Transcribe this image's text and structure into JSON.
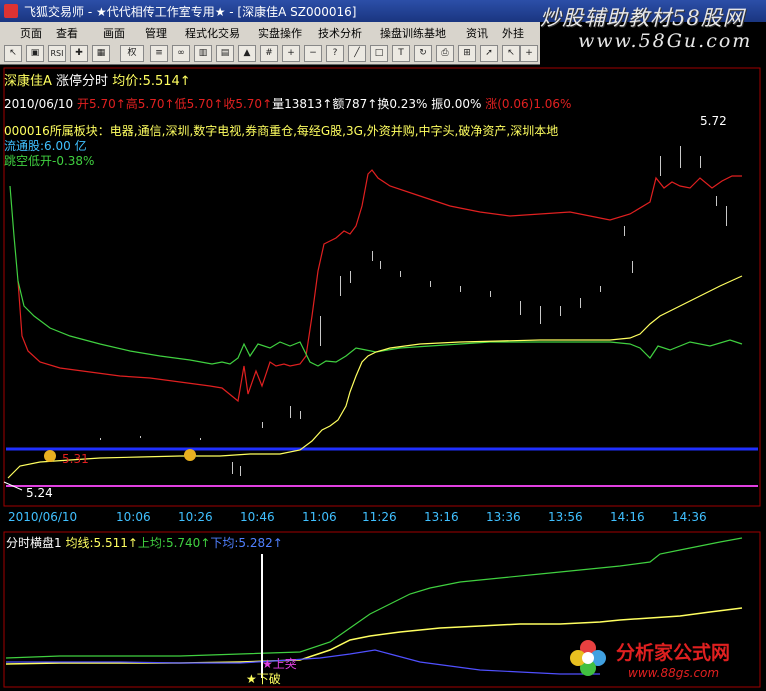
{
  "window": {
    "title": "飞狐交易师 - ★代代相传工作室专用★ - [深康佳A  SZ000016]"
  },
  "watermark": {
    "text": "炒股辅助教材58股网",
    "url": "www.58Gu.com"
  },
  "menu": {
    "items": [
      "页面",
      "查看",
      "画面",
      "管理",
      "程式化交易",
      "实盘操作",
      "技术分析",
      "操盘训练基地",
      "资讯",
      "外挂"
    ]
  },
  "toolbar": {
    "rsi": "RSI",
    "quan": "权"
  },
  "header": {
    "line1": {
      "name": "深康佳A",
      "indicator": "涨停分时",
      "avg": "均价:5.514↑"
    },
    "line2": {
      "date": "2010/06/10",
      "open": "开5.70↑",
      "high": "高5.70↑",
      "low": "低5.70↑",
      "close": "收5.70↑",
      "vol": "量13813↑",
      "amount": "额787↑",
      "turnover": "换0.23%",
      "amplitude": "振0.00%",
      "change": "涨(0.06)1.06%"
    },
    "sectors": "000016所属板块：电器,通信,深圳,数字电视,券商重仓,每经G股,3G,外资并购,中字头,破净资产,深圳本地",
    "float": "流通股:6.00 亿",
    "gap": "跳空低开-0.38%"
  },
  "annotations": {
    "low_price": "5.24",
    "price_31": "5.31",
    "high_price": "5.72"
  },
  "time_axis": [
    "2010/06/10",
    "10:06",
    "10:26",
    "10:46",
    "11:06",
    "11:26",
    "13:16",
    "13:36",
    "13:56",
    "14:16",
    "14:36"
  ],
  "lower": {
    "name": "分时横盘1",
    "avg": "均线:5.511↑",
    "upper": "上均:5.740↑",
    "lower_avg": "下均:5.282↑",
    "signal_break": "★下破",
    "signal_up": "★上突"
  },
  "logo": {
    "text": "分析家公式网",
    "url": "www.88gs.com"
  },
  "colors": {
    "red": "#e02020",
    "green": "#40d040",
    "yellow": "#ffff60",
    "blue": "#2030ff",
    "magenta": "#e040e0",
    "cyan": "#40c0ff"
  }
}
